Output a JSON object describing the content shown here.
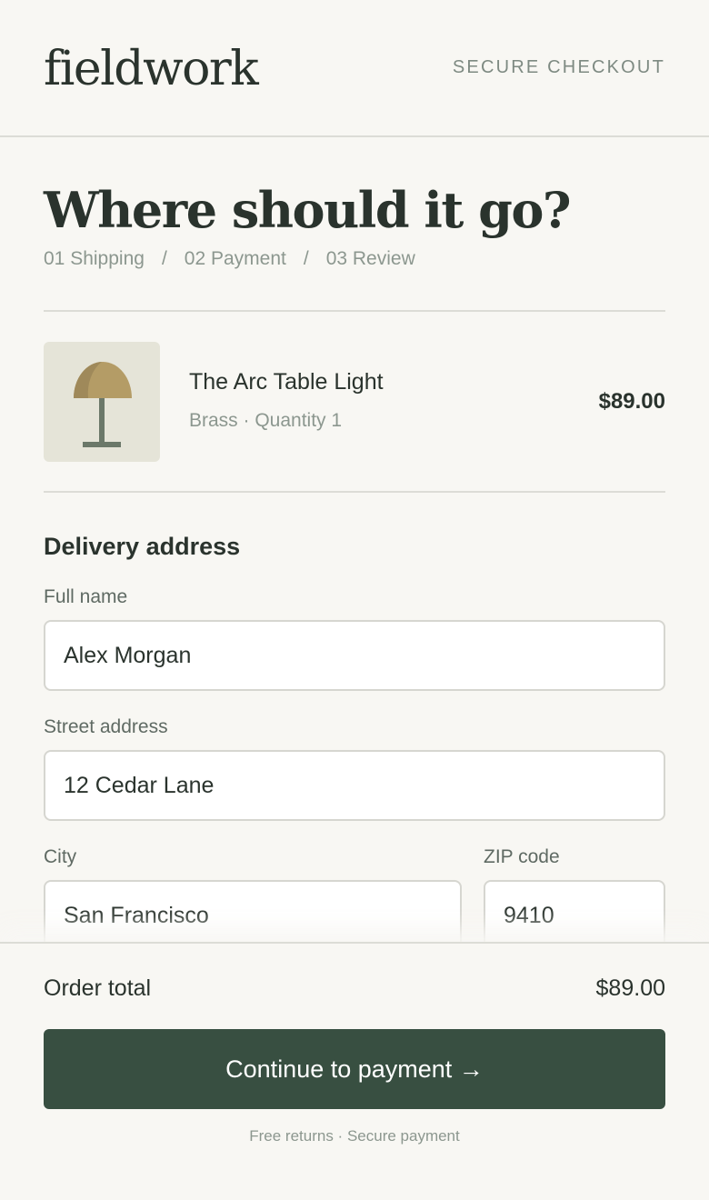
{
  "header": {
    "logo": "fieldwork",
    "secure_label": "SECURE CHECKOUT"
  },
  "page": {
    "title": "Where should it go?",
    "steps": [
      "01 Shipping",
      "02 Payment",
      "03 Review"
    ],
    "separator": "/"
  },
  "product": {
    "name": "The Arc Table Light",
    "meta": "Brass · Quantity 1",
    "price": "$89.00",
    "icon": "table-lamp"
  },
  "delivery": {
    "section_title": "Delivery address",
    "full_name": {
      "label": "Full name",
      "value": "Alex Morgan"
    },
    "street": {
      "label": "Street address",
      "value": "12 Cedar Lane"
    },
    "city": {
      "label": "City",
      "value": "San Francisco"
    },
    "zip": {
      "label": "ZIP code",
      "value": "9410"
    }
  },
  "summary": {
    "total_label": "Order total",
    "total_value": "$89.00",
    "cta_label": "Continue to payment →",
    "footnote": "Free returns · Secure payment"
  },
  "colors": {
    "background": "#f8f7f3",
    "text": "#2a332d",
    "muted": "#8c978f",
    "accent": "#384f41",
    "thumb_bg": "#e5e4d8",
    "lamp_brass": "#b49c66"
  }
}
